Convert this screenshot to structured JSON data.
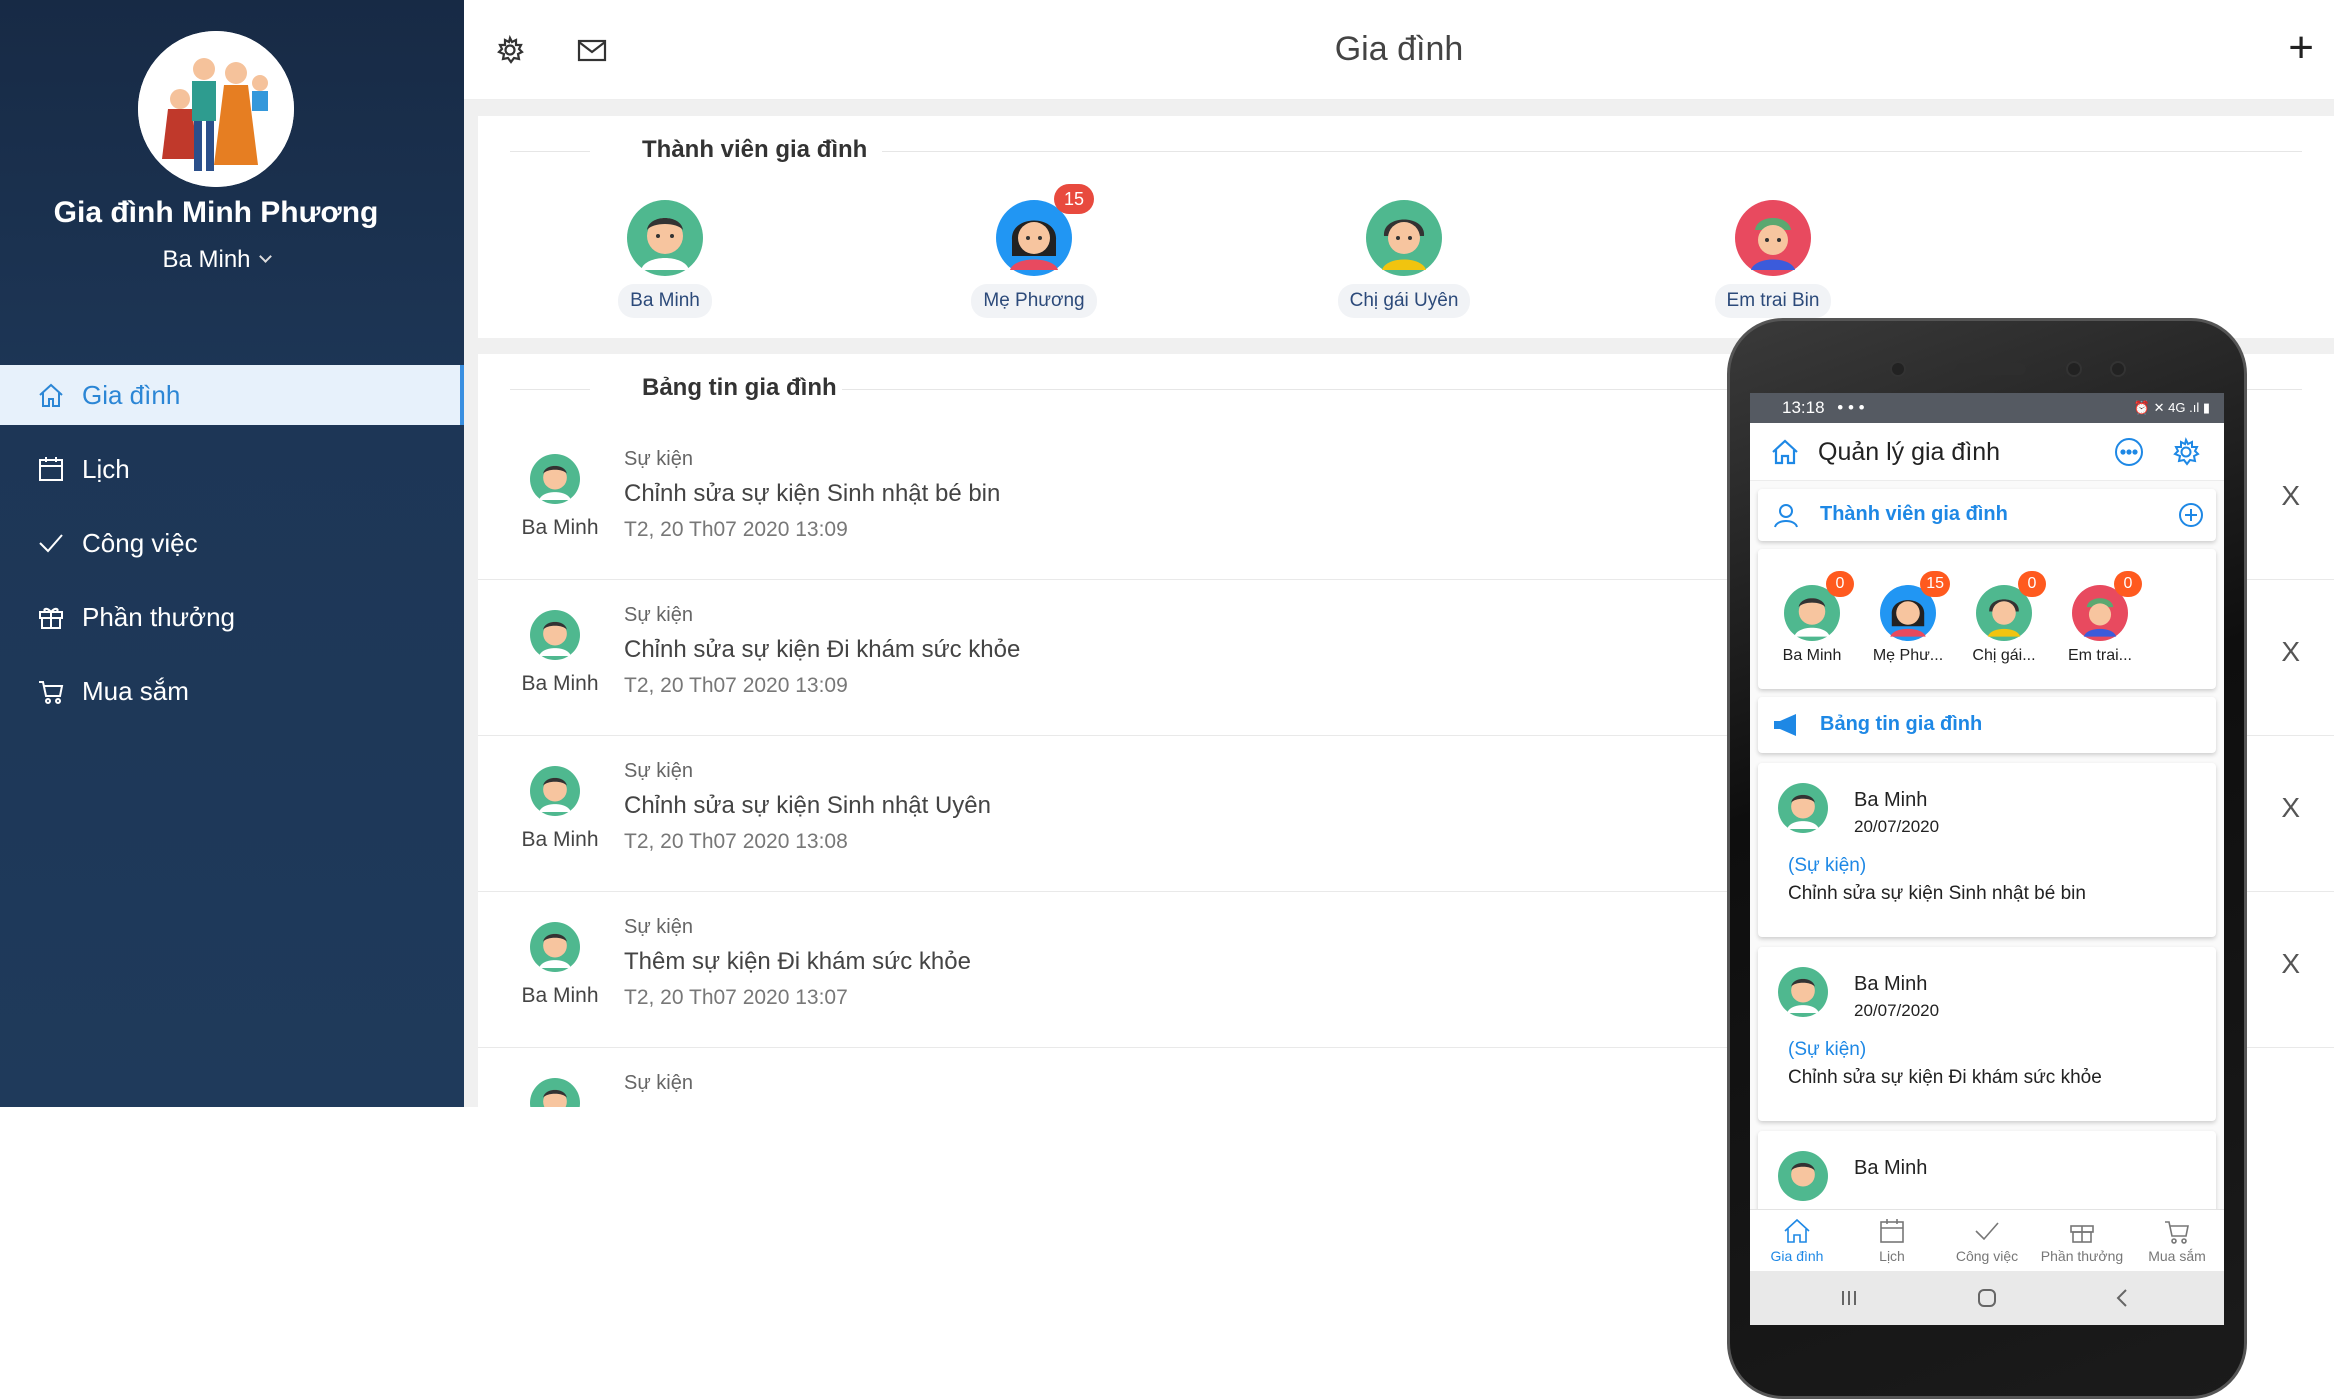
{
  "sidebar": {
    "family_name": "Gia đình Minh Phương",
    "current_user": "Ba Minh",
    "nav": [
      {
        "label": "Gia đình",
        "icon": "home-icon",
        "active": true
      },
      {
        "label": "Lịch",
        "icon": "calendar-icon",
        "active": false
      },
      {
        "label": "Công việc",
        "icon": "check-icon",
        "active": false
      },
      {
        "label": "Phần thưởng",
        "icon": "gift-icon",
        "active": false
      },
      {
        "label": "Mua sắm",
        "icon": "cart-icon",
        "active": false
      }
    ]
  },
  "topbar": {
    "title": "Gia đình",
    "left_icons": [
      "settings-icon",
      "mail-icon"
    ],
    "add_label": "+"
  },
  "members": {
    "heading": "Thành viên gia đình",
    "items": [
      {
        "name": "Ba Minh",
        "badge": "",
        "avatar_color": "#4fb88f"
      },
      {
        "name": "Mẹ Phương",
        "badge": "15",
        "avatar_color": "#2196f3"
      },
      {
        "name": "Chị gái Uyên",
        "badge": "",
        "avatar_color": "#4fb88f"
      },
      {
        "name": "Em trai Bin",
        "badge": "",
        "avatar_color": "#e84a5f"
      }
    ]
  },
  "feed": {
    "heading": "Bảng tin gia đình",
    "items": [
      {
        "author": "Ba Minh",
        "category": "Sự kiện",
        "text": "Chỉnh sửa sự kiện Sinh nhật bé bin",
        "time": "T2, 20 Th07 2020 13:09",
        "close": "X"
      },
      {
        "author": "Ba Minh",
        "category": "Sự kiện",
        "text": "Chỉnh sửa sự kiện Đi khám sức khỏe",
        "time": "T2, 20 Th07 2020 13:09",
        "close": "X"
      },
      {
        "author": "Ba Minh",
        "category": "Sự kiện",
        "text": "Chỉnh sửa sự kiện Sinh nhật Uyên",
        "time": "T2, 20 Th07 2020 13:08",
        "close": "X"
      },
      {
        "author": "Ba Minh",
        "category": "Sự kiện",
        "text": "Thêm sự kiện Đi khám sức khỏe",
        "time": "T2, 20 Th07 2020 13:07",
        "close": "X"
      },
      {
        "author": "",
        "category": "Sự kiện",
        "text": "",
        "time": "",
        "close": ""
      }
    ]
  },
  "mobile": {
    "status_time": "13:18",
    "status_icons": "• • •",
    "status_right": "⏰ ✕ 4G .ıl ▮",
    "app_title": "Quản lý gia đình",
    "members_heading": "Thành viên gia đình",
    "members": [
      {
        "name": "Ba Minh",
        "badge": "0",
        "avatar_color": "#4fb88f"
      },
      {
        "name": "Mẹ Phư...",
        "badge": "15",
        "avatar_color": "#2196f3"
      },
      {
        "name": "Chị gái...",
        "badge": "0",
        "avatar_color": "#4fb88f"
      },
      {
        "name": "Em trai...",
        "badge": "0",
        "avatar_color": "#e84a5f"
      }
    ],
    "feed_heading": "Bảng tin gia đình",
    "posts": [
      {
        "author": "Ba Minh",
        "date": "20/07/2020",
        "category": "(Sự kiện)",
        "text": "Chỉnh sửa sự kiện Sinh nhật bé bin"
      },
      {
        "author": "Ba Minh",
        "date": "20/07/2020",
        "category": "(Sự kiện)",
        "text": "Chỉnh sửa sự kiện Đi khám sức khỏe"
      },
      {
        "author": "Ba Minh",
        "date": "",
        "category": "",
        "text": ""
      }
    ],
    "bottom_nav": [
      {
        "label": "Gia đình",
        "icon": "home-icon",
        "active": true
      },
      {
        "label": "Lịch",
        "icon": "calendar-icon",
        "active": false
      },
      {
        "label": "Công việc",
        "icon": "check-icon",
        "active": false
      },
      {
        "label": "Phần thưởng",
        "icon": "gift-icon",
        "active": false
      },
      {
        "label": "Mua sắm",
        "icon": "cart-icon",
        "active": false
      }
    ]
  },
  "colors": {
    "sidebar": "#1d3656",
    "accent": "#2b86d5",
    "mobile_accent": "#1e88e5",
    "badge": "#e84a3e",
    "mobile_badge": "#ff5a1f"
  }
}
